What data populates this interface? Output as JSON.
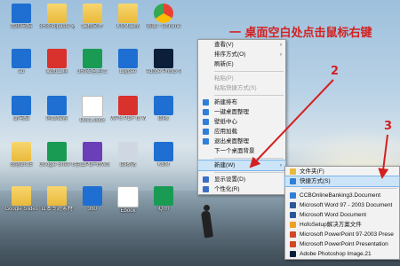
{
  "desktop_icons": [
    {
      "label": "我的电脑",
      "kind": "blue"
    },
    {
      "label": "3H3Snipaste xyb",
      "kind": "folder"
    },
    {
      "label": "编程文件",
      "kind": "folder"
    },
    {
      "label": "KSM工程",
      "kind": "folder"
    },
    {
      "label": "谷歌 - Chrome",
      "kind": "chrome"
    },
    {
      "label": "ab",
      "kind": "blue"
    },
    {
      "label": "截图工具",
      "kind": "red"
    },
    {
      "label": "360安全卫士",
      "kind": "green"
    },
    {
      "label": "Lilycee",
      "kind": "blue"
    },
    {
      "label": "Adobe Photo shop 2020",
      "kind": "ps"
    },
    {
      "label": "此电脑",
      "kind": "blue"
    },
    {
      "label": "网络位置",
      "kind": "blue"
    },
    {
      "label": "Doc1.docx",
      "kind": "doc"
    },
    {
      "label": "WPS PDF to Wordfdd",
      "kind": "red"
    },
    {
      "label": "回收",
      "kind": "blue"
    },
    {
      "label": "设置2015",
      "kind": "folder"
    },
    {
      "label": "Google Shee ts",
      "kind": "green"
    },
    {
      "label": "金山PDF转Word",
      "kind": "purple"
    },
    {
      "label": "回收站",
      "kind": "bin"
    },
    {
      "label": "KSM",
      "kind": "blue"
    },
    {
      "label": "Google Slides",
      "kind": "folder"
    },
    {
      "label": "日本专题素材",
      "kind": "folder"
    },
    {
      "label": "360",
      "kind": "blue"
    },
    {
      "label": "Ebook",
      "kind": "doc"
    },
    {
      "label": "iQIYI",
      "kind": "green"
    }
  ],
  "annotations": {
    "step1": "一  桌面空白处点击鼠标右键",
    "step2": "2",
    "step3": "3"
  },
  "context_menu": {
    "items": [
      {
        "label": "查看(V)",
        "submenu": true,
        "disabled": false,
        "sep_after": false
      },
      {
        "label": "排序方式(O)",
        "submenu": true,
        "disabled": false,
        "sep_after": false
      },
      {
        "label": "刷新(E)",
        "submenu": false,
        "disabled": false,
        "sep_after": true
      },
      {
        "label": "粘贴(P)",
        "submenu": false,
        "disabled": true,
        "sep_after": false
      },
      {
        "label": "粘贴快捷方式(S)",
        "submenu": false,
        "disabled": true,
        "sep_after": true
      },
      {
        "label": "新建排布",
        "submenu": false,
        "disabled": false,
        "sep_after": false,
        "icon": "#2f7fd8"
      },
      {
        "label": "一键桌面整理",
        "submenu": false,
        "disabled": false,
        "sep_after": false,
        "icon": "#2f7fd8"
      },
      {
        "label": "壁纸中心",
        "submenu": false,
        "disabled": false,
        "sep_after": false,
        "icon": "#2f7fd8"
      },
      {
        "label": "应用加载",
        "submenu": false,
        "disabled": false,
        "sep_after": false,
        "icon": "#2f7fd8"
      },
      {
        "label": "退出桌面整理",
        "submenu": false,
        "disabled": false,
        "sep_after": false,
        "icon": "#2f7fd8"
      },
      {
        "label": "下一个桌面背景",
        "submenu": false,
        "disabled": false,
        "sep_after": true
      },
      {
        "label": "新建(W)",
        "submenu": true,
        "disabled": false,
        "sep_after": true,
        "highlight": true
      },
      {
        "label": "显示设置(D)",
        "submenu": false,
        "disabled": false,
        "sep_after": false,
        "icon": "#3b6fc7"
      },
      {
        "label": "个性化(R)",
        "submenu": false,
        "disabled": false,
        "sep_after": false,
        "icon": "#3b6fc7"
      }
    ]
  },
  "new_submenu": {
    "items": [
      {
        "label": "文件夹(F)",
        "icon": "#e9b93b"
      },
      {
        "label": "快捷方式(S)",
        "icon": "#2f7fd8",
        "highlight": true,
        "sep_after": true
      },
      {
        "label": "CCBOnlineBanking3.Document",
        "icon": "#2f7fd8"
      },
      {
        "label": "Microsoft Word 97 - 2003 Document",
        "icon": "#2b579a"
      },
      {
        "label": "Microsoft Word Document",
        "icon": "#2b579a"
      },
      {
        "label": "HofoSetup解决方案文件",
        "icon": "#f0a020"
      },
      {
        "label": "Microsoft PowerPoint 97-2003 Prese",
        "icon": "#d24726"
      },
      {
        "label": "Microsoft PowerPoint Presentation",
        "icon": "#d24726"
      },
      {
        "label": "Adobe Photoshop Image.21",
        "icon": "#0b1e3a"
      }
    ]
  }
}
